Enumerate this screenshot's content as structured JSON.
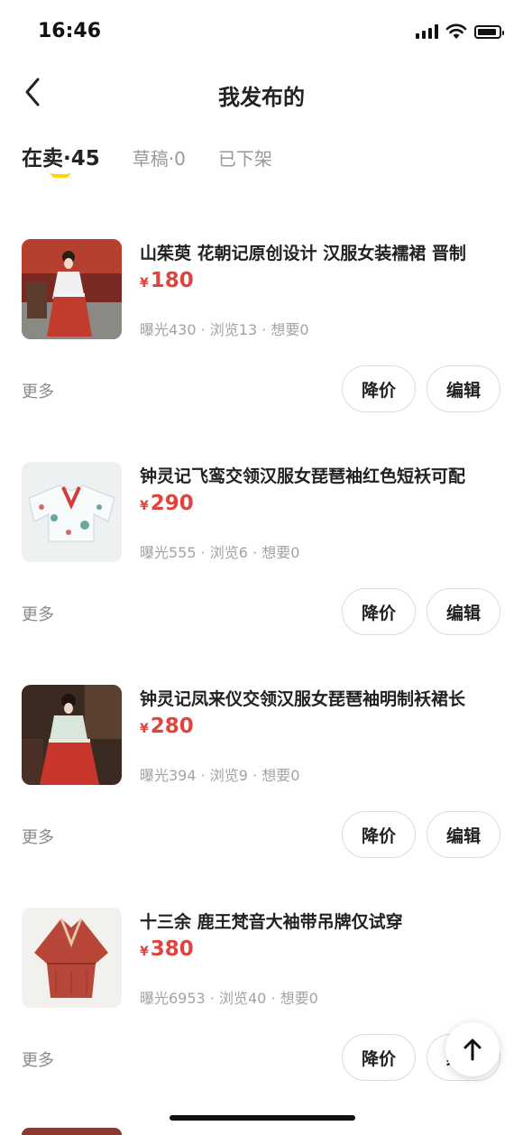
{
  "status_bar": {
    "time": "16:46"
  },
  "header": {
    "title": "我发布的"
  },
  "tabs": [
    {
      "label": "在卖·45",
      "active": true
    },
    {
      "label": "草稿·0",
      "active": false
    },
    {
      "label": "已下架",
      "active": false
    }
  ],
  "items": [
    {
      "title": "山茱萸 花朝记原创设计 汉服女装襦裙 晋制",
      "currency": "¥",
      "price": "180",
      "stats": "曝光430 · 浏览13 · 想要0",
      "more": "更多",
      "price_cut": "降价",
      "edit": "编辑"
    },
    {
      "title": "钟灵记飞鸾交领汉服女琵琶袖红色短袄可配",
      "currency": "¥",
      "price": "290",
      "stats": "曝光555 · 浏览6 · 想要0",
      "more": "更多",
      "price_cut": "降价",
      "edit": "编辑"
    },
    {
      "title": "钟灵记凤来仪交领汉服女琵琶袖明制袄裙长",
      "currency": "¥",
      "price": "280",
      "stats": "曝光394 · 浏览9 · 想要0",
      "more": "更多",
      "price_cut": "降价",
      "edit": "编辑"
    },
    {
      "title": "十三余 鹿王梵音大袖带吊牌仅试穿",
      "currency": "¥",
      "price": "380",
      "stats": "曝光6953 · 浏览40 · 想要0",
      "more": "更多",
      "price_cut": "降价",
      "edit": "编辑"
    }
  ],
  "colors": {
    "accent_yellow": "#ffd600",
    "price_red": "#e0443f"
  }
}
